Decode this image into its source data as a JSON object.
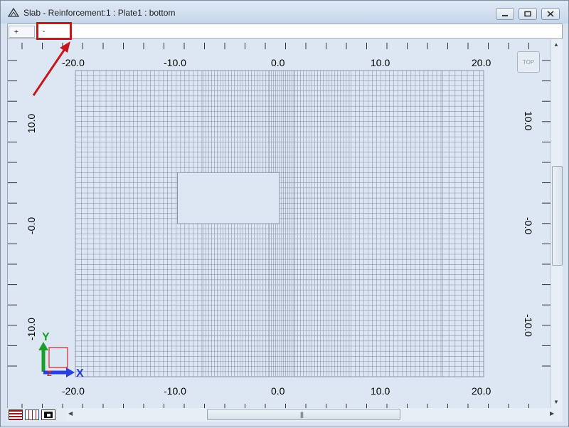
{
  "window": {
    "title": "Slab - Reinforcement:1 : Plate1  : bottom"
  },
  "tabs": [
    {
      "label": "+"
    },
    {
      "label": "-"
    }
  ],
  "view_cube": {
    "label": "TOP"
  },
  "axes": {
    "x_labels": [
      "-20.0",
      "-10.0",
      "0.0",
      "10.0",
      "20.0"
    ],
    "y_labels_left": [
      "10.0",
      "-0.0",
      "-10.0"
    ],
    "y_labels_right": [
      "10.0",
      "-0.0",
      "-10.0"
    ],
    "x_range": [
      -20.0,
      20.0
    ],
    "y_range": [
      -15.0,
      15.0
    ]
  },
  "coord_system": {
    "y_axis": "Y",
    "x_axis": "X",
    "z_axis": "Z",
    "colors": {
      "y": "#1a9e2a",
      "x": "#2a3fe0",
      "z": "#d9232a"
    }
  },
  "mesh": {
    "slab_x": [
      -20.0,
      20.0
    ],
    "slab_y": [
      -15.0,
      15.0
    ],
    "opening_x": [
      -10.0,
      0.0
    ],
    "opening_y": [
      0.0,
      5.0
    ],
    "bands": [
      {
        "x": [
          -20.0,
          -16.0
        ],
        "spacing": 0.6
      },
      {
        "x": [
          -16.0,
          -7.5
        ],
        "spacing": 0.42
      },
      {
        "x": [
          -7.5,
          -1.0
        ],
        "spacing": 0.28
      },
      {
        "x": [
          -1.0,
          1.5
        ],
        "spacing": 0.2
      },
      {
        "x": [
          1.5,
          7.0
        ],
        "spacing": 0.28
      },
      {
        "x": [
          7.0,
          16.0
        ],
        "spacing": 0.42
      },
      {
        "x": [
          16.0,
          20.0
        ],
        "spacing": 0.6
      }
    ],
    "row_spacing": 0.5,
    "colors": {
      "line": "#8c97a6",
      "fill": "#dde7f4"
    }
  },
  "colors": {
    "accent": "#c8161e",
    "titlebar": "#cddcee"
  }
}
